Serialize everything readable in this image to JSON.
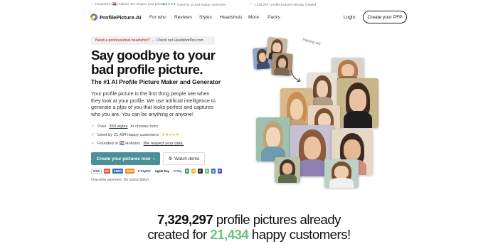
{
  "topbar": {
    "items": [
      "Founded in 🇳🇱 Holland. We respect your privacy.",
      "Used by 21,434 happy customers",
      "7,329,297+ profile pictures already created"
    ],
    "stars": "★★★★★"
  },
  "nav": {
    "brand": "ProfilePicture.AI",
    "links": [
      "For who",
      "Reviews",
      "Styles",
      "Headshots",
      "More",
      "Packs"
    ],
    "login": "Login",
    "create": "Create your PFP"
  },
  "hero": {
    "promo_highlight": "Need a professional headshot?",
    "promo_text": "→ Check out HeadshotPro.com",
    "title": "Say goodbye to your bad profile picture.",
    "subtitle": "The #1 AI Profile Picture Maker and Generator",
    "description": "Your profile picture is the first thing people see when they look at your profile. We use artificial intelligence to generate a pfps of you that looks perfect and captures who you are. You can be anything or anyone!",
    "checks": {
      "styles_pre": "Over",
      "styles_link": "350 styles",
      "styles_post": "to choose from",
      "users": "Used by 21,434 happy customers",
      "founded_pre": "Founded in 🇳🇱 Holland.",
      "founded_link": "We respect your data."
    },
    "cta": "Create your pictures now",
    "cta_arrow": "›",
    "demo": "Watch demo",
    "demo_icon": "⚙",
    "payments": [
      "VISA",
      "MC",
      "AMEX",
      "DISC",
      "P PayPal",
      "Apple Pay",
      "G Pay",
      "G",
      "N",
      "C",
      "G",
      "Q",
      "P"
    ],
    "payment_note": "One-time payment. No subscription.",
    "collage_note": "Training set"
  },
  "bottom": {
    "count1": "7,329,297",
    "text1": "profile pictures already",
    "text2": "created for",
    "count2": "21,434",
    "text3": "happy customers!"
  },
  "colors": {
    "accent": "#4a9098",
    "green": "#6cc27e",
    "promo_red": "#d4503b"
  }
}
